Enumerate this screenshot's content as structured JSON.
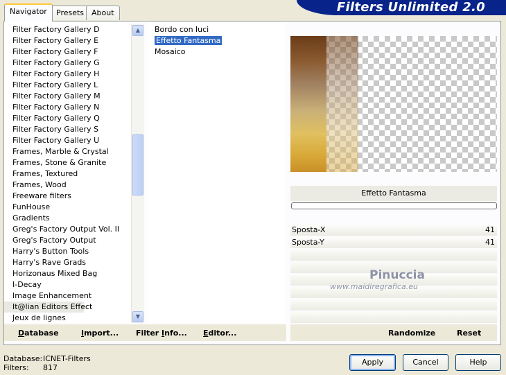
{
  "tabs": [
    {
      "label": "Navigator"
    },
    {
      "label": "Presets"
    },
    {
      "label": "About"
    }
  ],
  "banner_title": "Filters Unlimited 2.0",
  "categories": [
    "Filter Factory Gallery D",
    "Filter Factory Gallery E",
    "Filter Factory Gallery F",
    "Filter Factory Gallery G",
    "Filter Factory Gallery H",
    "Filter Factory Gallery L",
    "Filter Factory Gallery M",
    "Filter Factory Gallery N",
    "Filter Factory Gallery Q",
    "Filter Factory Gallery S",
    "Filter Factory Gallery U",
    "Frames, Marble & Crystal",
    "Frames, Stone & Granite",
    "Frames, Textured",
    "Frames, Wood",
    "Freeware filters",
    "FunHouse",
    "Gradients",
    "Greg's Factory Output Vol. II",
    "Greg's Factory Output",
    "Harry's Button Tools",
    "Harry's Rave Grads",
    "Horizonaus Mixed Bag",
    "I-Decay",
    "Image Enhancement",
    "It@lian Editors Effect",
    "Jeux de lignes"
  ],
  "selected_category": "It@lian Editors Effect",
  "filters": [
    "Bordo con luci",
    "Effetto Fantasma",
    "Mosaico"
  ],
  "selected_filter": "Effetto Fantasma",
  "filter_name_display": "Effetto Fantasma",
  "sliders": [
    {
      "label": "Sposta-X",
      "value": "41"
    },
    {
      "label": "Sposta-Y",
      "value": "41"
    }
  ],
  "watermark": {
    "line1": "Pinuccia",
    "line2": "www.maidiregrafica.eu"
  },
  "left_buttons": [
    {
      "ul": "D",
      "rest": "atabase"
    },
    {
      "ul": "I",
      "rest": "mport..."
    },
    {
      "pre": "Filter ",
      "ul": "I",
      "rest": "nfo..."
    },
    {
      "ul": "E",
      "rest": "ditor..."
    }
  ],
  "right_buttons": {
    "randomize": "Randomize",
    "reset": "Reset"
  },
  "status": {
    "database_label": "Database:",
    "database_value": "ICNET-Filters",
    "filters_label": "Filters:",
    "filters_value": "817"
  },
  "dialog_buttons": {
    "apply": "Apply",
    "cancel": "Cancel",
    "help": "Help"
  },
  "colors": {
    "selection": "#316ac5",
    "banner": "#08238a"
  }
}
